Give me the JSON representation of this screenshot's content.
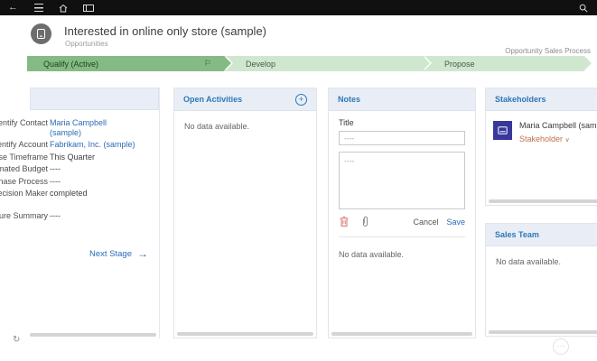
{
  "colors": {
    "topbar_bg": "#101010",
    "accent_blue": "#2f77b5",
    "link_blue": "#2b6cb8",
    "stage_active_bg": "#84ba84",
    "stage_inactive_bg": "#cfe7cf",
    "panel_header_bg": "#e9eef6",
    "stakeholder_role_orange": "#c0714f",
    "avatar_indigo": "#38389b"
  },
  "topbar": {
    "back_icon": "←"
  },
  "header": {
    "title": "Interested in online only store (sample)",
    "subtitle": "Opportunities"
  },
  "process": {
    "label": "Opportunity Sales Process",
    "flag_icon": "⚐",
    "stages": [
      {
        "name": "Qualify (Active)"
      },
      {
        "name": "Develop"
      },
      {
        "name": "Propose"
      }
    ]
  },
  "fields_panel": {
    "fields": [
      {
        "label": "Identify Contact",
        "value": "Maria Campbell (sample)"
      },
      {
        "label": "Identify Account",
        "value": "Fabrikam, Inc. (sample)"
      },
      {
        "label": "Purchase Timeframe",
        "value": "This Quarter"
      },
      {
        "label": "Estimated Budget",
        "value": "----"
      },
      {
        "label": "Purchase Process",
        "value": "----"
      },
      {
        "label": "Identify Decision Maker",
        "value": "completed"
      },
      {
        "label": "Capture Summary",
        "value": "----"
      }
    ],
    "next_stage_label": "Next Stage",
    "next_stage_arrow": "→"
  },
  "open_activities": {
    "title": "Open Activities",
    "add_icon": "+",
    "empty_text": "No data available."
  },
  "notes": {
    "title": "Notes",
    "note_title_label": "Title",
    "note_title_placeholder": "----",
    "note_body_placeholder": "----",
    "cancel_label": "Cancel",
    "save_label": "Save",
    "empty_text": "No data available."
  },
  "stakeholders": {
    "title": "Stakeholders",
    "items": [
      {
        "name": "Maria Campbell (sample)",
        "role": "Stakeholder",
        "chevron": "∨"
      }
    ]
  },
  "sales_team": {
    "title": "Sales Team",
    "empty_text": "No data available."
  },
  "footer": {
    "refresh_icon": "↻",
    "more_icon": "⋯"
  }
}
